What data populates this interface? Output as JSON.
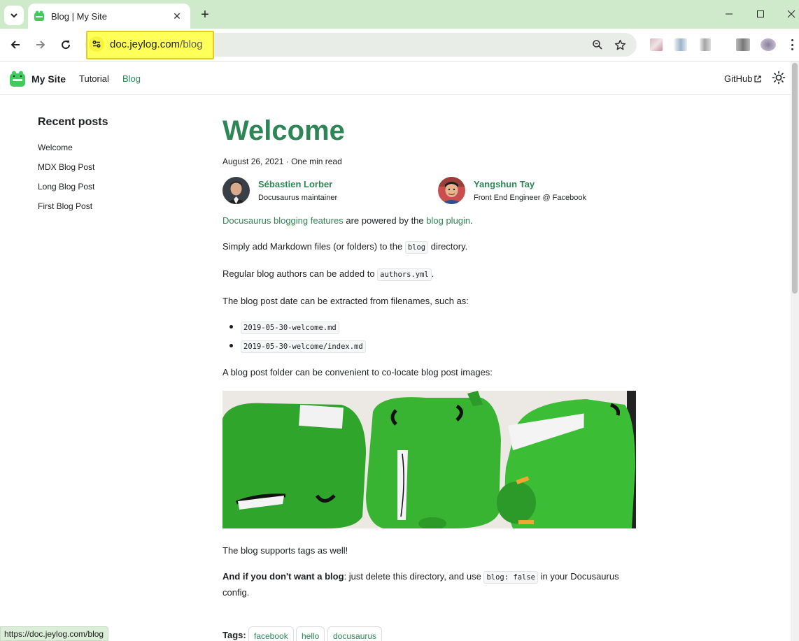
{
  "browser": {
    "tab_title": "Blog | My Site",
    "url_host": "doc.jeylog.com",
    "url_path": "/blog",
    "status_url": "https://doc.jeylog.com/blog"
  },
  "navbar": {
    "brand": "My Site",
    "links": [
      "Tutorial",
      "Blog"
    ],
    "active_link": "Blog",
    "github": "GitHub"
  },
  "sidebar": {
    "title": "Recent posts",
    "posts": [
      "Welcome",
      "MDX Blog Post",
      "Long Blog Post",
      "First Blog Post"
    ]
  },
  "post": {
    "title": "Welcome",
    "meta": "August 26, 2021 · One min read",
    "authors": [
      {
        "name": "Sébastien Lorber",
        "role": "Docusaurus maintainer"
      },
      {
        "name": "Yangshun Tay",
        "role": "Front End Engineer @ Facebook"
      }
    ],
    "p1_link1": "Docusaurus blogging features",
    "p1_mid": " are powered by the ",
    "p1_link2": "blog plugin",
    "p1_end": ".",
    "p2_start": "Simply add Markdown files (or folders) to the ",
    "p2_code": "blog",
    "p2_end": " directory.",
    "p3_start": "Regular blog authors can be added to ",
    "p3_code": "authors.yml",
    "p3_end": ".",
    "p4": "The blog post date can be extracted from filenames, such as:",
    "list": [
      "2019-05-30-welcome.md",
      "2019-05-30-welcome/index.md"
    ],
    "p5": "A blog post folder can be convenient to co-locate blog post images:",
    "p6": "The blog supports tags as well!",
    "p7_bold": "And if you don't want a blog",
    "p7_mid": ": just delete this directory, and use ",
    "p7_code": "blog: false",
    "p7_end": " in your Docusaurus",
    "p7_line2": "config.",
    "tags_label": "Tags:",
    "tags": [
      "facebook",
      "hello",
      "docusaurus"
    ]
  },
  "colors": {
    "primary": "#2e8555",
    "chrome_tabstrip": "#cfeacb",
    "url_highlight": "#ffff59"
  }
}
